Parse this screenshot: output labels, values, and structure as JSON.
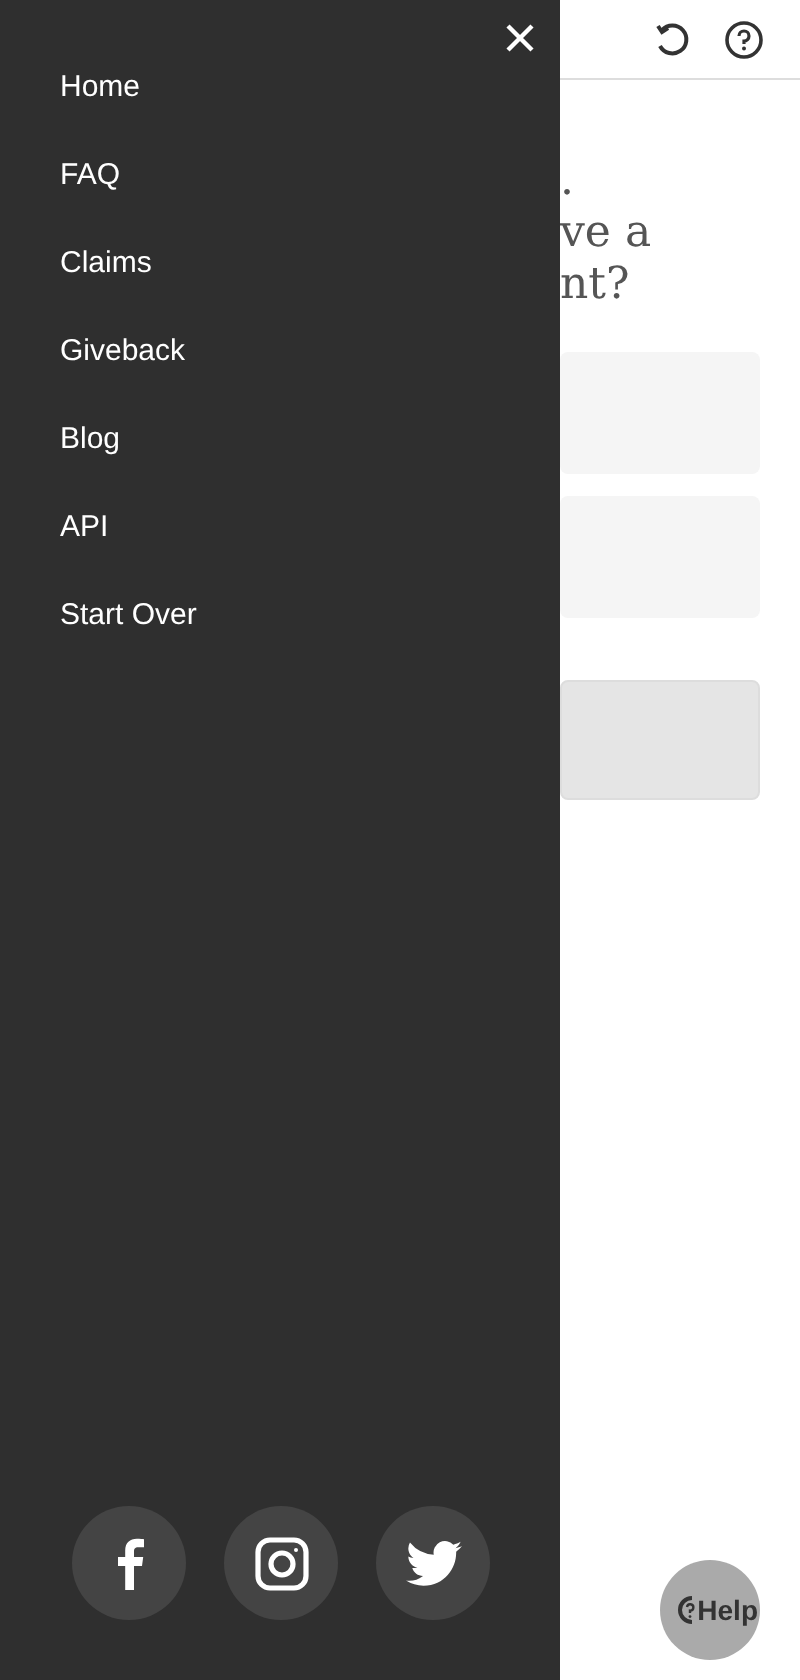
{
  "menu": {
    "items": [
      {
        "label": "Home"
      },
      {
        "label": "FAQ"
      },
      {
        "label": "Claims"
      },
      {
        "label": "Giveback"
      },
      {
        "label": "Blog"
      },
      {
        "label": "API"
      },
      {
        "label": "Start Over"
      }
    ]
  },
  "page": {
    "heading_lines": [
      ".",
      "ve a",
      "nt?"
    ]
  },
  "help_button": {
    "label": "Help"
  }
}
